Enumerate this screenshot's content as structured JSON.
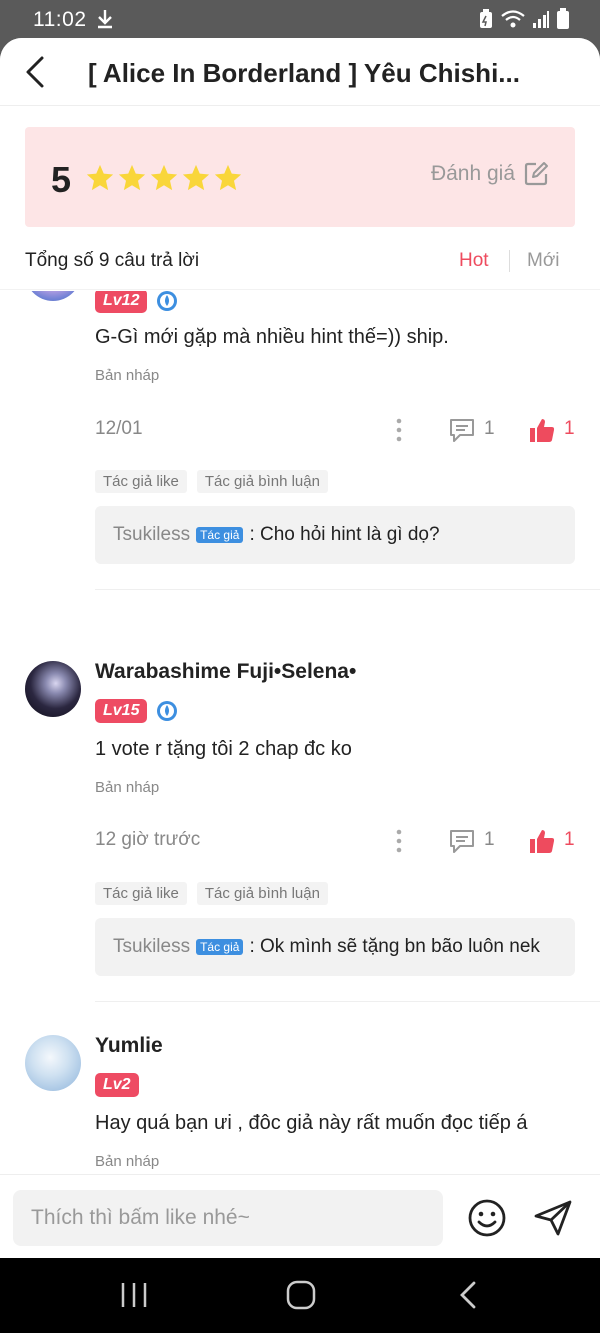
{
  "status_bar": {
    "time": "11:02"
  },
  "header": {
    "title": "[ Alice In Borderland ] Yêu Chishi..."
  },
  "rating": {
    "score": "5",
    "stars": 5,
    "rate_label": "Đánh giá"
  },
  "summary": {
    "total": "Tổng số 9 câu trả lời",
    "sort_hot": "Hot",
    "sort_new": "Mới"
  },
  "comments": [
    {
      "level": "Lv12",
      "text": "G-Gì mới gặp mà nhiều hint thế=)) ship.",
      "draft": "Bản nháp",
      "time": "12/01",
      "replies": "1",
      "likes": "1",
      "tags": [
        "Tác giả like",
        "Tác giả bình luận"
      ],
      "reply": {
        "author": "Tsukiless",
        "badge": "Tác giả",
        "text": ": Cho hỏi hint là gì dọ?"
      }
    },
    {
      "username": "Warabashime Fuji•Selena•",
      "level": "Lv15",
      "text": "1 vote r tặng tôi 2 chap đc ko",
      "draft": "Bản nháp",
      "time": "12 giờ trước",
      "replies": "1",
      "likes": "1",
      "tags": [
        "Tác giả like",
        "Tác giả bình luận"
      ],
      "reply": {
        "author": "Tsukiless",
        "badge": "Tác giả",
        "text": ": Ok mình sẽ tặng bn bão luôn nek"
      }
    },
    {
      "username": "Yumlie",
      "level": "Lv2",
      "text": "Hay quá bạn ưi , đôc giả này rất muốn đọc tiếp á",
      "draft": "Bản nháp"
    }
  ],
  "input": {
    "placeholder": "Thích thì bấm like nhé~"
  },
  "colors": {
    "accent": "#ee4b5e",
    "rating_bg": "#fde5e6",
    "star": "#f9d63a",
    "author_badge": "#3d8fe0"
  }
}
